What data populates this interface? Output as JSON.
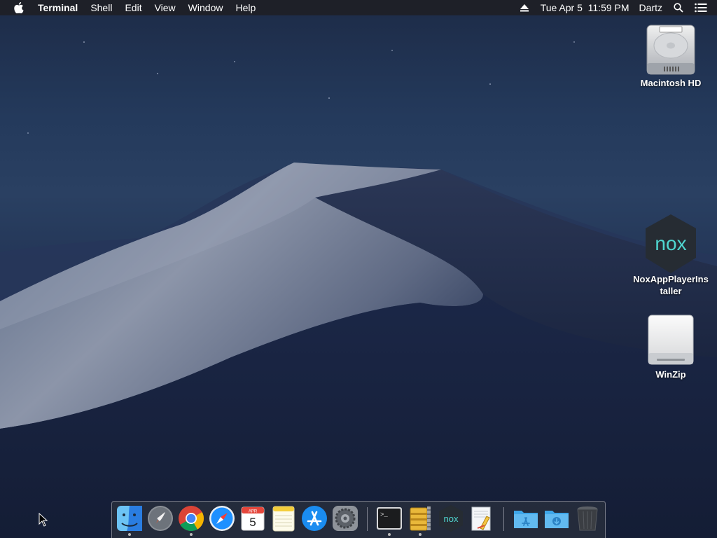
{
  "menubar": {
    "app_name": "Terminal",
    "menus": [
      "Shell",
      "Edit",
      "View",
      "Window",
      "Help"
    ],
    "clock": "Tue Apr 5  11:59 PM",
    "user": "Dartz",
    "icons": [
      "apple-icon",
      "eject-icon",
      "spotlight-search-icon",
      "notification-center-icon"
    ]
  },
  "desktop_icons": [
    {
      "label": "Macintosh HD",
      "icon": "hard-drive-icon"
    },
    {
      "label": "NoxAppPlayerIns taller",
      "icon": "nox-icon"
    },
    {
      "label": "WinZip",
      "icon": "removable-drive-icon"
    }
  ],
  "dock": {
    "items": [
      {
        "name": "Finder",
        "icon": "finder-icon",
        "running": true
      },
      {
        "name": "Launchpad",
        "icon": "launchpad-icon",
        "running": false
      },
      {
        "name": "Google Chrome",
        "icon": "chrome-icon",
        "running": true
      },
      {
        "name": "Safari",
        "icon": "safari-icon",
        "running": false
      },
      {
        "name": "Calendar",
        "icon": "calendar-icon",
        "running": false,
        "month": "APR",
        "day": "5"
      },
      {
        "name": "Notes",
        "icon": "notes-icon",
        "running": false
      },
      {
        "name": "App Store",
        "icon": "app-store-icon",
        "running": false
      },
      {
        "name": "System Preferences",
        "icon": "system-preferences-icon",
        "running": false
      },
      {
        "name": "Terminal",
        "icon": "terminal-icon",
        "running": true
      },
      {
        "name": "Archive Utility",
        "icon": "archive-utility-icon",
        "running": true
      },
      {
        "name": "Nox",
        "icon": "nox-icon",
        "running": false
      },
      {
        "name": "TextEdit",
        "icon": "textedit-icon",
        "running": false
      },
      {
        "name": "Applications",
        "icon": "applications-folder-icon",
        "running": false
      },
      {
        "name": "Downloads",
        "icon": "downloads-folder-icon",
        "running": false
      },
      {
        "name": "Trash",
        "icon": "trash-icon",
        "running": false
      }
    ],
    "terminal_prompt": ">_",
    "nox_text": "nox"
  },
  "colors": {
    "menubar_bg": "#1e2026",
    "nox_accent": "#4fd6d0",
    "folder_blue": "#3ea6e8"
  }
}
